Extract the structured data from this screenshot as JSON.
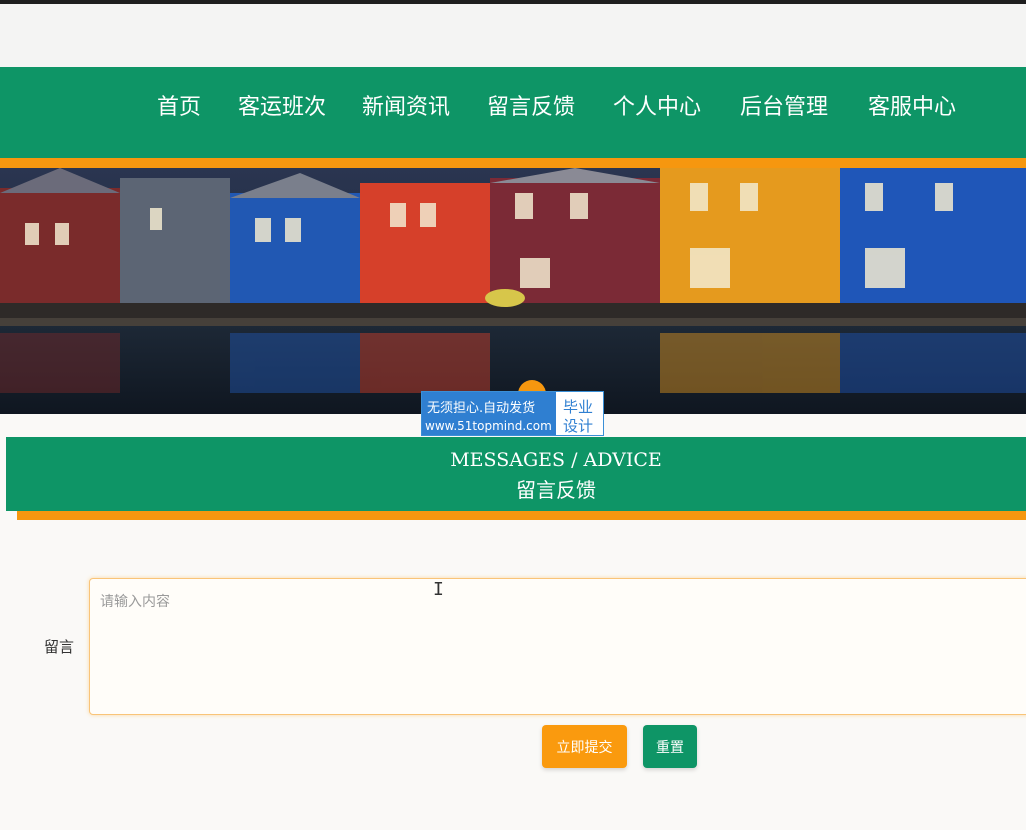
{
  "nav": {
    "items": [
      {
        "label": "首页"
      },
      {
        "label": "客运班次"
      },
      {
        "label": "新闻资讯"
      },
      {
        "label": "留言反馈"
      },
      {
        "label": "个人中心"
      },
      {
        "label": "后台管理"
      },
      {
        "label": "客服中心"
      }
    ]
  },
  "badge": {
    "line1": "无须担心.自动发货",
    "line2": "www.51topmind.com",
    "right1": "毕业",
    "right2": "设计"
  },
  "section": {
    "title_en": "MESSAGES / ADVICE",
    "title_cn": "留言反馈"
  },
  "form": {
    "label": "留言",
    "placeholder": "请输入内容",
    "value": "",
    "submit_label": "立即提交",
    "reset_label": "重置"
  },
  "colors": {
    "primary": "#0e9566",
    "accent": "#f6970f"
  }
}
